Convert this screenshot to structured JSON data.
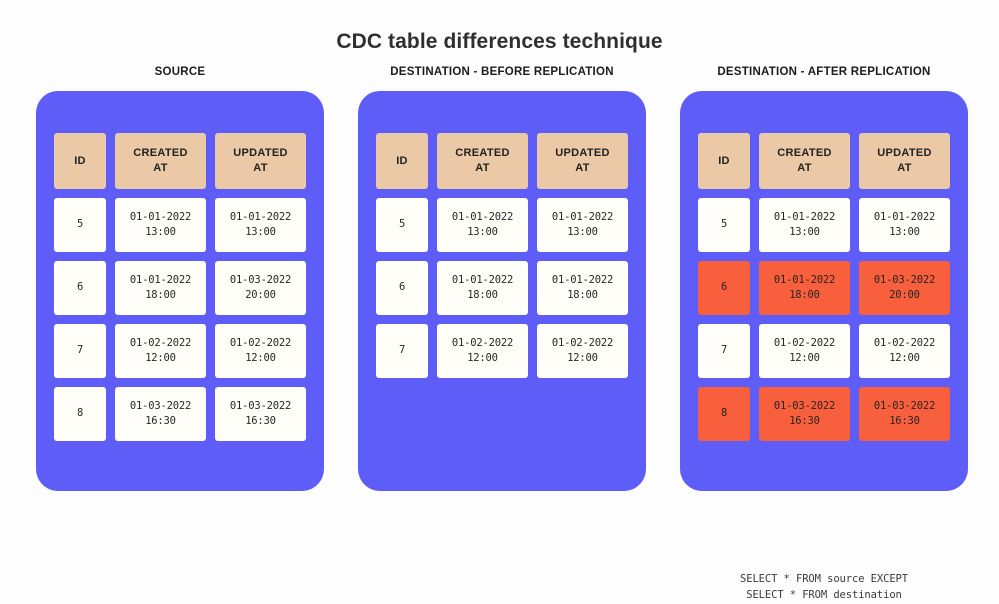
{
  "page": {
    "title": "CDC table differences technique",
    "background": "#fdfdfd",
    "card_color": "#5f5df8",
    "header_cell_color": "#ebc9a6",
    "highlight_color": "#f8603d",
    "cell_color": "#fffef8"
  },
  "columns": {
    "id": "ID",
    "created_at_line1": "CREATED",
    "created_at_line2": "AT",
    "updated_at_line1": "UPDATED",
    "updated_at_line2": "AT"
  },
  "panels": [
    {
      "heading": "SOURCE",
      "caption_line1": "",
      "caption_line2": "",
      "rows": [
        {
          "id": "5",
          "created_date": "01-01-2022",
          "created_time": "13:00",
          "updated_date": "01-01-2022",
          "updated_time": "13:00",
          "highlight": false
        },
        {
          "id": "6",
          "created_date": "01-01-2022",
          "created_time": "18:00",
          "updated_date": "01-03-2022",
          "updated_time": "20:00",
          "highlight": false
        },
        {
          "id": "7",
          "created_date": "01-02-2022",
          "created_time": "12:00",
          "updated_date": "01-02-2022",
          "updated_time": "12:00",
          "highlight": false
        },
        {
          "id": "8",
          "created_date": "01-03-2022",
          "created_time": "16:30",
          "updated_date": "01-03-2022",
          "updated_time": "16:30",
          "highlight": false
        }
      ]
    },
    {
      "heading": "DESTINATION - BEFORE REPLICATION",
      "caption_line1": "",
      "caption_line2": "",
      "rows": [
        {
          "id": "5",
          "created_date": "01-01-2022",
          "created_time": "13:00",
          "updated_date": "01-01-2022",
          "updated_time": "13:00",
          "highlight": false
        },
        {
          "id": "6",
          "created_date": "01-01-2022",
          "created_time": "18:00",
          "updated_date": "01-01-2022",
          "updated_time": "18:00",
          "highlight": false
        },
        {
          "id": "7",
          "created_date": "01-02-2022",
          "created_time": "12:00",
          "updated_date": "01-02-2022",
          "updated_time": "12:00",
          "highlight": false
        }
      ]
    },
    {
      "heading": "DESTINATION - AFTER REPLICATION",
      "caption_line1": "SELECT * FROM source EXCEPT",
      "caption_line2": "SELECT * FROM destination",
      "rows": [
        {
          "id": "5",
          "created_date": "01-01-2022",
          "created_time": "13:00",
          "updated_date": "01-01-2022",
          "updated_time": "13:00",
          "highlight": false
        },
        {
          "id": "6",
          "created_date": "01-01-2022",
          "created_time": "18:00",
          "updated_date": "01-03-2022",
          "updated_time": "20:00",
          "highlight": true
        },
        {
          "id": "7",
          "created_date": "01-02-2022",
          "created_time": "12:00",
          "updated_date": "01-02-2022",
          "updated_time": "12:00",
          "highlight": false
        },
        {
          "id": "8",
          "created_date": "01-03-2022",
          "created_time": "16:30",
          "updated_date": "01-03-2022",
          "updated_time": "16:30",
          "highlight": true
        }
      ]
    }
  ]
}
